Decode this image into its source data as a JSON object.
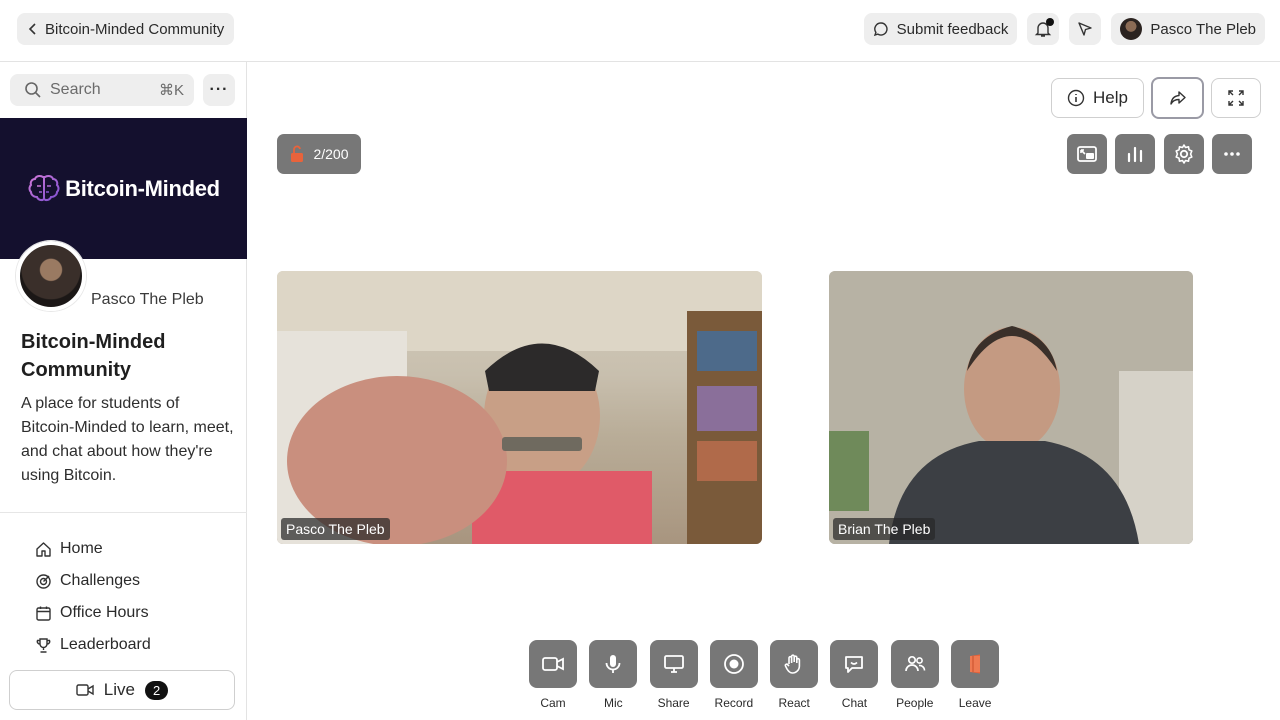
{
  "topbar": {
    "back_label": "Bitcoin-Minded Community",
    "feedback_label": "Submit feedback",
    "user_label": "Pasco The Pleb"
  },
  "sidebar": {
    "search_placeholder": "Search",
    "search_shortcut": "⌘K",
    "banner_text": "Bitcoin-Minded",
    "profile_name": "Pasco The Pleb",
    "community_title": "Bitcoin-Minded Community",
    "community_desc": "A place for students of Bitcoin-Minded to learn, meet, and chat about how they're using Bitcoin.",
    "nav": [
      {
        "label": "Home",
        "icon": "home-icon"
      },
      {
        "label": "Challenges",
        "icon": "target-icon"
      },
      {
        "label": "Office Hours",
        "icon": "calendar-icon"
      },
      {
        "label": "Leaderboard",
        "icon": "trophy-icon"
      }
    ],
    "live_label": "Live",
    "live_count": "2"
  },
  "main": {
    "help_label": "Help",
    "participant_count": "2/200",
    "participants": [
      {
        "name": "Pasco The Pleb"
      },
      {
        "name": "Brian The Pleb"
      }
    ],
    "controls": [
      {
        "label": "Cam",
        "icon": "camera-icon"
      },
      {
        "label": "Mic",
        "icon": "mic-icon"
      },
      {
        "label": "Share",
        "icon": "monitor-icon"
      },
      {
        "label": "Record",
        "icon": "record-icon"
      },
      {
        "label": "React",
        "icon": "hand-icon"
      },
      {
        "label": "Chat",
        "icon": "chat-icon"
      },
      {
        "label": "People",
        "icon": "people-icon"
      },
      {
        "label": "Leave",
        "icon": "door-icon"
      }
    ]
  },
  "colors": {
    "banner_bg": "#14102e",
    "control_gray": "#777777",
    "leave_accent": "#e8633b"
  }
}
